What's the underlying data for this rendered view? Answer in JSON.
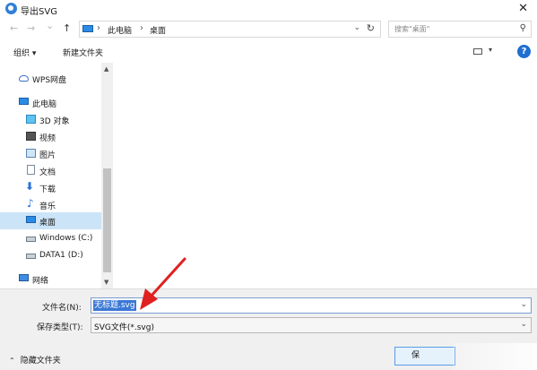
{
  "window": {
    "title": "导出SVG",
    "close": "✕"
  },
  "nav": {
    "back": "←",
    "forward": "→",
    "recent": "⌄",
    "up": "↑",
    "breadcrumb": [
      "此电脑",
      "桌面"
    ],
    "breadcrumb_sep": "›",
    "dropdown": "⌄",
    "refresh": "↻",
    "search_placeholder": "搜索\"桌面\"",
    "search_icon": "⚲"
  },
  "toolbar": {
    "organize": "组织 ▾",
    "new_folder": "新建文件夹",
    "view_dd": "▾",
    "help": "?"
  },
  "sidebar": {
    "items": [
      {
        "label": "WPS网盘",
        "icon": "cloud-icon"
      },
      {
        "label": "此电脑",
        "icon": "computer-icon"
      },
      {
        "label": "3D 对象",
        "icon": "3d-objects-icon"
      },
      {
        "label": "视频",
        "icon": "video-icon"
      },
      {
        "label": "图片",
        "icon": "pictures-icon"
      },
      {
        "label": "文档",
        "icon": "documents-icon"
      },
      {
        "label": "下载",
        "icon": "download-icon"
      },
      {
        "label": "音乐",
        "icon": "music-icon"
      },
      {
        "label": "桌面",
        "icon": "desktop-icon",
        "selected": true
      },
      {
        "label": "Windows (C:)",
        "icon": "drive-icon"
      },
      {
        "label": "DATA1 (D:)",
        "icon": "drive-icon"
      },
      {
        "label": "网络",
        "icon": "network-icon"
      }
    ],
    "glyphs": {
      "download": "⬇",
      "music": "♪",
      "scroll_up": "▲",
      "scroll_down": "▼",
      "chevron": "⌄"
    }
  },
  "form": {
    "filename_label": "文件名(N):",
    "filename_value": "无标题.svg",
    "filetype_label": "保存类型(T):",
    "filetype_value": "SVG文件(*.svg)",
    "dropdown": "⌄"
  },
  "footer": {
    "hide_folders": "隐藏文件夹",
    "hide_chevron": "⌃",
    "save_button": "保"
  },
  "colors": {
    "selection": "#cce4f7",
    "accent": "#3b78d6",
    "annotation_arrow": "#e02020"
  }
}
